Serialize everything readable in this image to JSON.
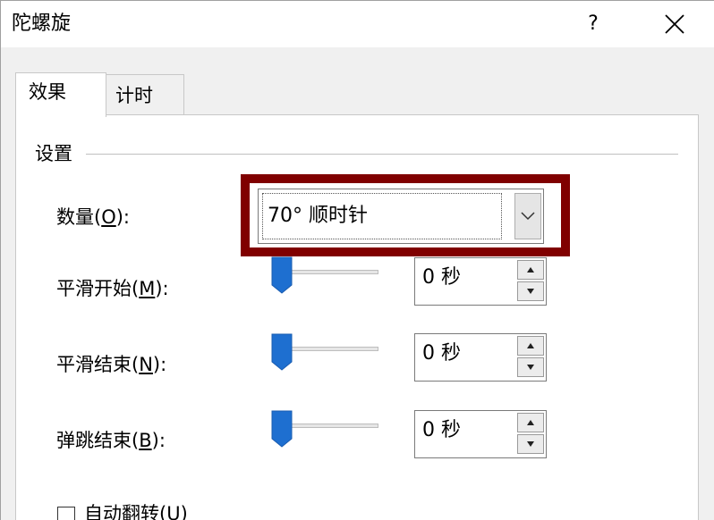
{
  "window": {
    "title": "陀螺旋",
    "help_label": "?"
  },
  "tabs": [
    {
      "label": "效果",
      "active": true
    },
    {
      "label": "计时",
      "active": false
    }
  ],
  "settings": {
    "group_label": "设置",
    "amount": {
      "label": "数量(",
      "mnemonic": "O",
      "label_suffix": "):",
      "value": "70° 顺时针"
    },
    "smooth_start": {
      "label": "平滑开始(",
      "mnemonic": "M",
      "label_suffix": "):",
      "value": "0 秒"
    },
    "smooth_end": {
      "label": "平滑结束(",
      "mnemonic": "N",
      "label_suffix": "):",
      "value": "0 秒"
    },
    "bounce_end": {
      "label": "弹跳结束(",
      "mnemonic": "B",
      "label_suffix": "):",
      "value": "0 秒"
    },
    "auto_reverse": {
      "label": "自动翻转(U)",
      "checked": false
    }
  },
  "colors": {
    "highlight": "#800000",
    "slider_thumb": "#1e6fd0"
  },
  "icons": {
    "close": "close-icon",
    "dropdown": "chevron-down-icon",
    "spin_up": "triangle-up-icon",
    "spin_down": "triangle-down-icon"
  }
}
